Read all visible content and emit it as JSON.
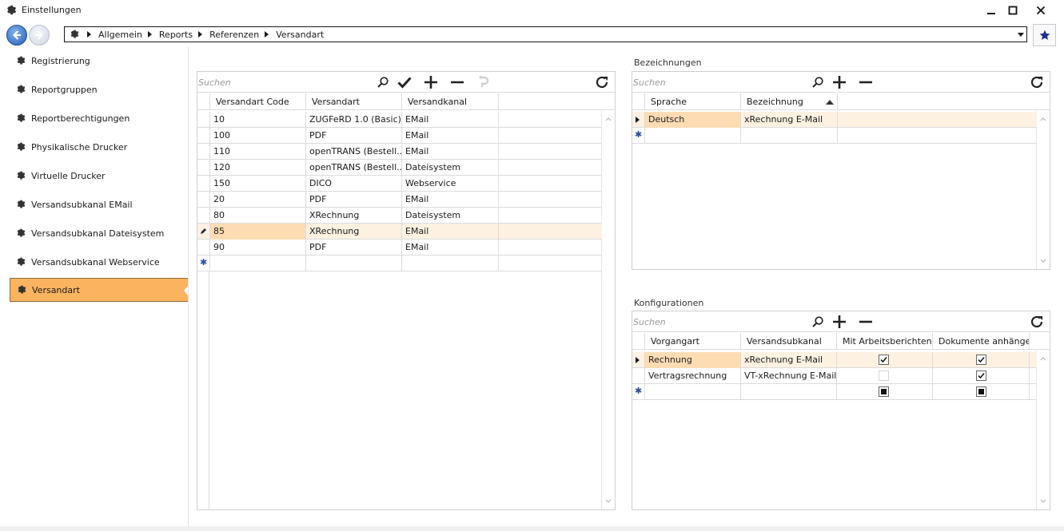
{
  "window": {
    "title": "Einstellungen"
  },
  "breadcrumb": {
    "items": [
      "Allgemein",
      "Reports",
      "Referenzen",
      "Versandart"
    ]
  },
  "sidebar": {
    "items": [
      {
        "label": "Registrierung",
        "active": false
      },
      {
        "label": "Reportgruppen",
        "active": false
      },
      {
        "label": "Reportberechtigungen",
        "active": false
      },
      {
        "label": "Physikalische Drucker",
        "active": false
      },
      {
        "label": "Virtuelle Drucker",
        "active": false
      },
      {
        "label": "Versandsubkanal EMail",
        "active": false
      },
      {
        "label": "Versandsubkanal Dateisystem",
        "active": false
      },
      {
        "label": "Versandsubkanal Webservice",
        "active": false
      },
      {
        "label": "Versandart",
        "active": true
      }
    ],
    "active_color": "#fbb35f"
  },
  "versandart_grid": {
    "search_placeholder": "Suchen",
    "columns": [
      "Versandart Code",
      "Versandart",
      "Versandkanal"
    ],
    "rows": [
      [
        "10",
        "ZUGFeRD 1.0 (Basic)",
        "EMail"
      ],
      [
        "100",
        "PDF",
        "EMail"
      ],
      [
        "110",
        "openTRANS (Bestell...",
        "EMail"
      ],
      [
        "120",
        "openTRANS (Bestell...",
        "Dateisystem"
      ],
      [
        "150",
        "DICO",
        "Webservice"
      ],
      [
        "20",
        "PDF",
        "EMail"
      ],
      [
        "80",
        "XRechnung",
        "Dateisystem"
      ],
      [
        "85",
        "XRechnung",
        "EMail"
      ],
      [
        "90",
        "PDF",
        "EMail"
      ]
    ],
    "selected_row": 7
  },
  "bezeichnungen": {
    "title": "Bezeichnungen",
    "search_placeholder": "Suchen",
    "columns": [
      "Sprache",
      "Bezeichnung"
    ],
    "rows": [
      [
        "Deutsch",
        "xRechnung E-Mail"
      ]
    ]
  },
  "konfigurationen": {
    "title": "Konfigurationen",
    "search_placeholder": "Suchen",
    "columns": [
      "Vorgangart",
      "Versandsubkanal",
      "Mit Arbeitsberichten",
      "Dokumente anhängen"
    ],
    "rows": [
      {
        "vorgangart": "Rechnung",
        "versandsubkanal": "xRechnung E-Mail",
        "mit_arbeitsberichten": true,
        "dokumente_anhaengen": true
      },
      {
        "vorgangart": "Vertragsrechnung",
        "versandsubkanal": "VT-xRechnung E-Mail",
        "mit_arbeitsberichten": false,
        "dokumente_anhaengen": true
      }
    ]
  },
  "colors": {
    "selected_row": "#fdf1e2",
    "selected_cell": "#fddcb4",
    "back_button": "#2a5fb8",
    "favorite_star": "#1f2f8a"
  }
}
